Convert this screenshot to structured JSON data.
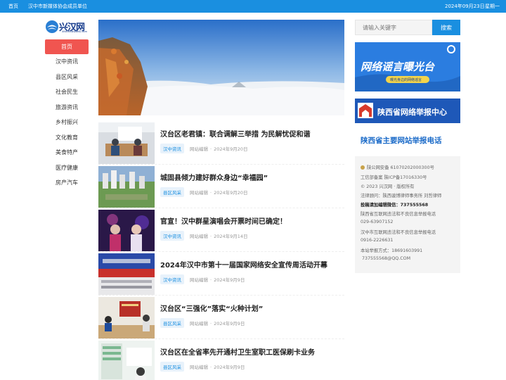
{
  "topbar": {
    "home": "首页",
    "org": "汉中市新媒体协会成员单位",
    "date": "2024年09月23日",
    "weekday": "星期一"
  },
  "logo": {
    "name": "兴汉网",
    "subtitle": "XINGHANWANG.com"
  },
  "nav": {
    "items": [
      "首页",
      "汉中资讯",
      "县区风采",
      "社会民生",
      "旅游资讯",
      "乡村振兴",
      "文化教育",
      "美食特产",
      "医疗健康",
      "房产汽车"
    ],
    "active_index": 0
  },
  "search": {
    "placeholder": "请输入关键字",
    "button": "搜索"
  },
  "news": [
    {
      "title": "汉台区老君镇：联合调解三举措 为民解忧促和谐",
      "tag": "汉中资讯",
      "source": "网站编辑",
      "date": "2024年9月20日"
    },
    {
      "title": "城固县倾力建好群众身边“幸福园”",
      "tag": "县区风采",
      "source": "网站编辑",
      "date": "2024年9月20日"
    },
    {
      "title": "官宣！汉中群星演唱会开票时间已确定！",
      "tag": "汉中资讯",
      "source": "网站编辑",
      "date": "2024年9月14日"
    },
    {
      "title": "2024年汉中市第十一届国家网络安全宣传周活动开幕",
      "tag": "汉中资讯",
      "source": "网站编辑",
      "date": "2024年9月9日"
    },
    {
      "title": "汉台区“三强化”落实“火种计划”",
      "tag": "县区风采",
      "source": "网站编辑",
      "date": "2024年9月9日"
    },
    {
      "title": "汉台区在全省率先开通村卫生室职工医保刷卡业务",
      "tag": "县区风采",
      "source": "网站编辑",
      "date": "2024年9月9日"
    }
  ],
  "sidebar": {
    "banner1_title": "网络谣言曝光台",
    "banner1_sub": "曝光身边的网络谣言",
    "banner2_title": "陕西省网络举报中心",
    "report_line": "陕西省主要网站举报电话",
    "info": {
      "beian": "陕公网安备 61070202000300号",
      "icp": "工信部备案 陕ICP备17016330号",
      "copyright": "© 2023 兴汉网 · 版权所有",
      "legal": "法律顾问：陕西骏博律师事务所 刘哲律师",
      "wechat": "投稿请加编辑微信：737555568",
      "report1": "陕西省互联网违法和不良信息举报电话",
      "phone1": "029-63907152",
      "report2": "汉中市互联网违法和不良信息举报电话",
      "phone2": "0916-2226631",
      "report3": "本站举报方式：18691603991",
      "email": "737555568@QQ.COM"
    }
  },
  "colors": {
    "topbar": "#1a8fe0",
    "nav_active": "#f05550",
    "tag_bg": "#e8f2fb",
    "tag_text": "#1a8fe0"
  }
}
